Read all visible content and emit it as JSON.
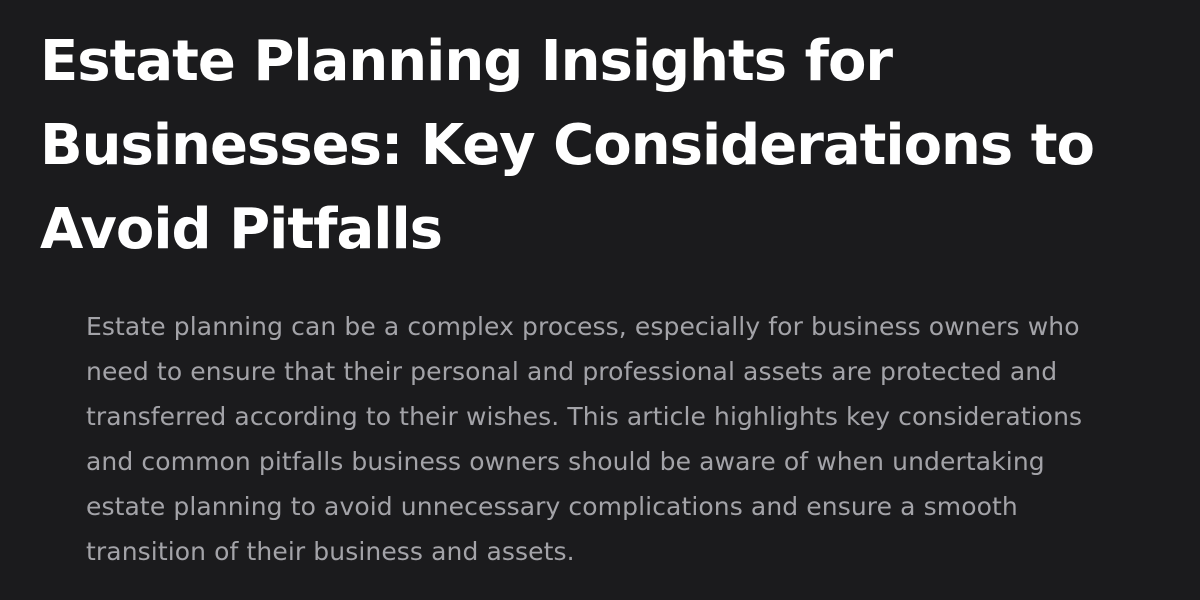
{
  "article": {
    "title": "Estate Planning Insights for Businesses: Key Considerations to Avoid Pitfalls",
    "excerpt": "Estate planning can be a complex process, especially for business owners who need to ensure that their personal and professional assets are protected and transferred according to their wishes. This article highlights key considerations and common pitfalls business owners should be aware of when undertaking estate planning to avoid unnecessary complications and ensure a smooth transition of their business and assets."
  },
  "colors": {
    "background": "#1b1b1d",
    "title": "#ffffff",
    "excerpt": "#a3a3a8"
  }
}
